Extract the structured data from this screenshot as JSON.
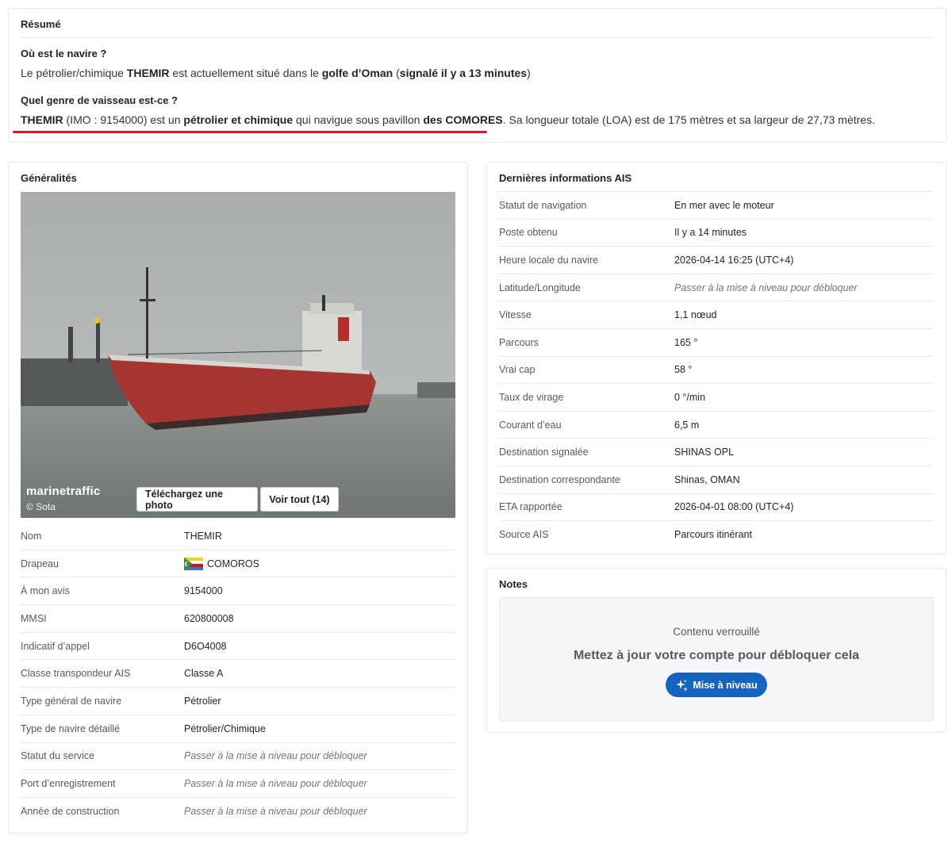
{
  "summary": {
    "title": "Résumé",
    "q1": "Où est le navire ?",
    "a1": {
      "p1": "Le pétrolier/chimique ",
      "ship": "THEMIR",
      "p2": " est actuellement situé dans le ",
      "area": "golfe d’Oman",
      "p3": " (",
      "reported": "signalé il y a 13 minutes",
      "p4": ")"
    },
    "q2": "Quel genre de vaisseau est-ce ?",
    "a2": {
      "ship": "THEMIR",
      "p1": " (IMO : 9154000) est un ",
      "type": "pétrolier et chimique",
      "p2": " qui navigue sous pavillon ",
      "flag": "des COMORES",
      "p3": ". Sa longueur totale (LOA) est de 175 mètres et sa largeur de 27,73 mètres."
    },
    "highlight_color": "#d41c1c"
  },
  "general": {
    "title": "Généralités",
    "photo": {
      "watermark": "marinetraffic",
      "copyright": "© Sota",
      "upload_label": "Téléchargez une photo",
      "viewall_label": "Voir tout (14)"
    },
    "rows": [
      {
        "key": "Nom",
        "value": "THEMIR"
      },
      {
        "key": "Drapeau",
        "value": "COMOROS",
        "icon": "comoros-flag-icon"
      },
      {
        "key": "À mon avis",
        "value": "9154000"
      },
      {
        "key": "MMSI",
        "value": "620800008"
      },
      {
        "key": "Indicatif d’appel",
        "value": "D6O4008"
      },
      {
        "key": "Classe transpondeur AIS",
        "value": "Classe A"
      },
      {
        "key": "Type général de navire",
        "value": "Pétrolier"
      },
      {
        "key": "Type de navire détaillé",
        "value": "Pétrolier/Chimique"
      },
      {
        "key": "Statut du service",
        "value": "Passer à la mise à niveau pour débloquer"
      },
      {
        "key": "Port d’enregistrement",
        "value": "Passer à la mise à niveau pour débloquer"
      },
      {
        "key": "Année de construction",
        "value": "Passer à la mise à niveau pour débloquer"
      }
    ]
  },
  "ais": {
    "title": "Dernières informations AIS",
    "rows": [
      {
        "key": "Statut de navigation",
        "value": "En mer avec le moteur"
      },
      {
        "key": "Poste obtenu",
        "value": "Il y a 14 minutes"
      },
      {
        "key": "Heure locale du navire",
        "value": "2026-04-14 16:25 (UTC+4)"
      },
      {
        "key": "Latitude/Longitude",
        "value": "Passer à la mise à niveau pour débloquer"
      },
      {
        "key": "Vitesse",
        "value": "1,1 nœud"
      },
      {
        "key": "Parcours",
        "value": "165 °"
      },
      {
        "key": "Vrai cap",
        "value": "58 °"
      },
      {
        "key": "Taux de virage",
        "value": "0 °/min"
      },
      {
        "key": "Courant d’eau",
        "value": "6,5 m"
      },
      {
        "key": "Destination signalée",
        "value": "SHINAS OPL"
      },
      {
        "key": "Destination correspondante",
        "value": "Shinas, OMAN"
      },
      {
        "key": "ETA rapportée",
        "value": "2026-04-01 08:00 (UTC+4)"
      },
      {
        "key": "Source AIS",
        "value": "Parcours itinérant"
      }
    ]
  },
  "notes": {
    "title": "Notes",
    "locked_small": "Contenu verrouillé",
    "locked_big": "Mettez à jour votre compte pour débloquer cela",
    "upgrade_label": "Mise à niveau",
    "upgrade_icon": "sparkle-icon",
    "accent": "#1565c0"
  }
}
